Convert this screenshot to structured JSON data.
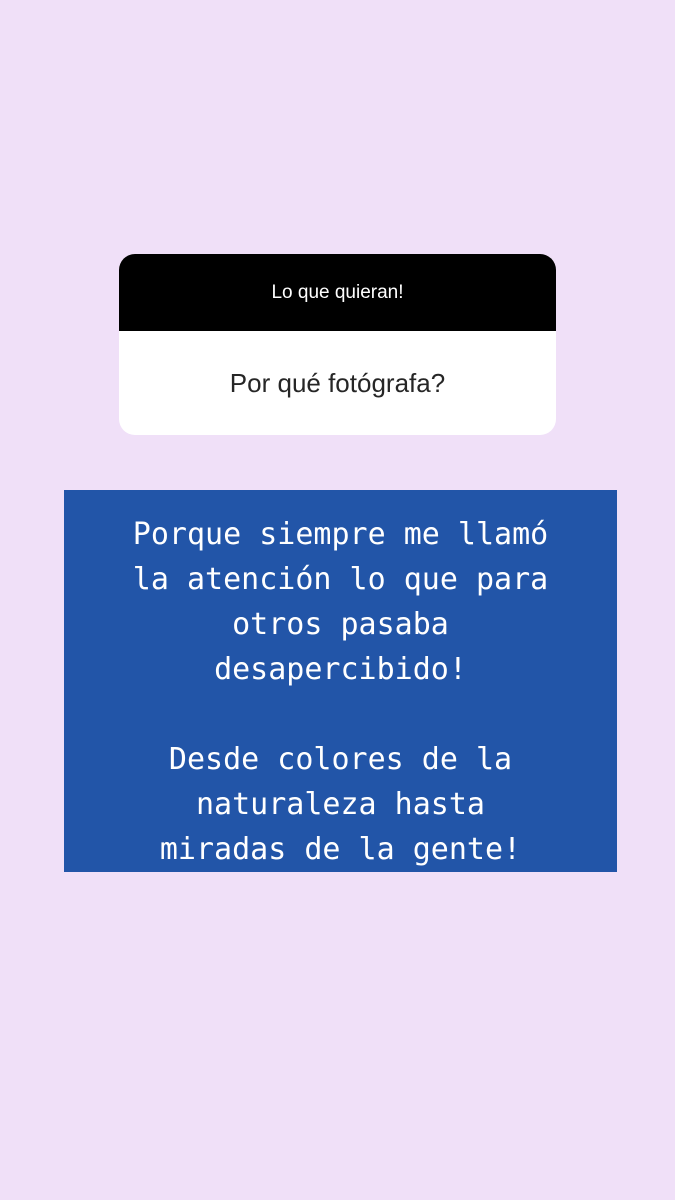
{
  "story": {
    "background_color": "#f0e0f8",
    "question_card": {
      "prompt": "Lo que quieran!",
      "question": "Por qué fotógrafa?"
    },
    "answer": {
      "background_color": "#2255a8",
      "paragraph1": [
        "Porque siempre me llamó",
        "la atención lo que para",
        "otros pasaba",
        "desapercibido!"
      ],
      "paragraph2": [
        "Desde colores de la",
        "naturaleza hasta",
        "miradas de la gente!"
      ]
    }
  }
}
